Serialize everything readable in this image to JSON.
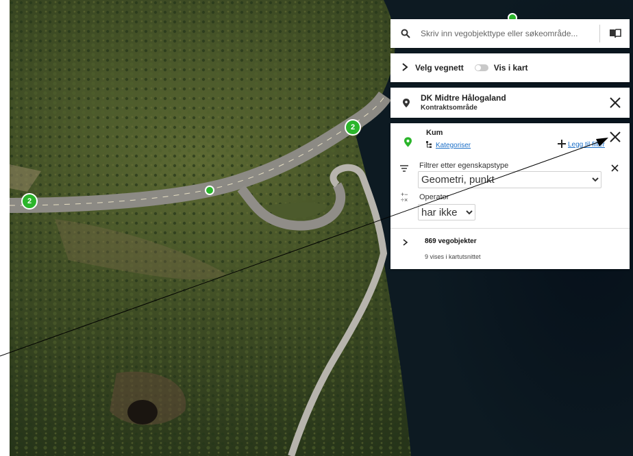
{
  "search": {
    "placeholder": "Skriv inn vegobjekttype eller søkeområde..."
  },
  "vegnett": {
    "label": "Velg vegnett",
    "toggle_label": "Vis i kart",
    "toggle_on": false
  },
  "area": {
    "name": "DK Midtre Hålogaland",
    "type": "Kontraktsområde"
  },
  "object": {
    "name": "Kum",
    "categorize_link": "Kategoriser",
    "add_filter_link": "Legg til filter",
    "filter_label": "Filtrer etter egenskapstype",
    "filter_value": "Geometri, punkt",
    "operator_label": "Operator",
    "operator_value": "har ikke",
    "count": "869 vegobjekter",
    "shown": "9 vises i kartutsnittet"
  },
  "map": {
    "clusters": [
      {
        "label": "2"
      },
      {
        "label": "2"
      }
    ],
    "marker_color": "#2bb52b"
  },
  "icons": [
    "search-icon",
    "book-icon",
    "chevron-right-icon",
    "map-pin-icon",
    "close-icon",
    "hierarchy-icon",
    "plus-icon",
    "filter-icon",
    "operator-icon"
  ]
}
